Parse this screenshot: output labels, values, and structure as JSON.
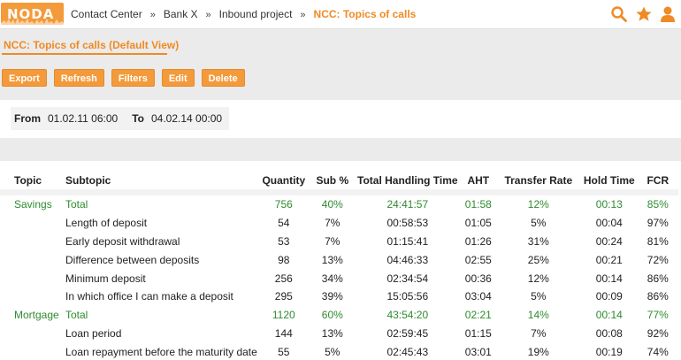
{
  "app": {
    "logo": "NODA"
  },
  "breadcrumb": [
    "Contact Center",
    "Bank X",
    "Inbound project"
  ],
  "breadcrumb_current": "NCC: Topics of calls",
  "page_title": "NCC: Topics of calls (Default View)",
  "toolbar": {
    "export": "Export",
    "refresh": "Refresh",
    "filters": "Filters",
    "edit": "Edit",
    "delete": "Delete"
  },
  "period": {
    "from_label": "From",
    "from_value": "01.02.11 06:00",
    "to_label": "To",
    "to_value": "04.02.14 00:00"
  },
  "colors": {
    "accent": "#f08a24",
    "total_green": "#2e8b2e"
  },
  "icons": [
    "search-icon",
    "star-icon",
    "user-icon"
  ],
  "table": {
    "columns": [
      "Topic",
      "Subtopic",
      "Quantity",
      "Sub %",
      "Total Handling Time",
      "AHT",
      "Transfer Rate",
      "Hold Time",
      "FCR"
    ],
    "rows": [
      [
        "Savings",
        "Total",
        "756",
        "40%",
        "24:41:57",
        "01:58",
        "12%",
        "00:13",
        "85%"
      ],
      [
        "",
        "Length of deposit",
        "54",
        "7%",
        "00:58:53",
        "01:05",
        "5%",
        "00:04",
        "97%"
      ],
      [
        "",
        "Early deposit withdrawal",
        "53",
        "7%",
        "01:15:41",
        "01:26",
        "31%",
        "00:24",
        "81%"
      ],
      [
        "",
        "Difference between deposits",
        "98",
        "13%",
        "04:46:33",
        "02:55",
        "25%",
        "00:21",
        "72%"
      ],
      [
        "",
        "Minimum deposit",
        "256",
        "34%",
        "02:34:54",
        "00:36",
        "12%",
        "00:14",
        "86%"
      ],
      [
        "",
        "In which office I can make a deposit",
        "295",
        "39%",
        "15:05:56",
        "03:04",
        "5%",
        "00:09",
        "86%"
      ],
      [
        "Mortgage",
        "Total",
        "1120",
        "60%",
        "43:54:20",
        "02:21",
        "14%",
        "00:14",
        "77%"
      ],
      [
        "",
        "Loan period",
        "144",
        "13%",
        "02:59:45",
        "01:15",
        "7%",
        "00:08",
        "92%"
      ],
      [
        "",
        "Loan repayment before the maturity date",
        "55",
        "5%",
        "02:45:43",
        "03:01",
        "19%",
        "00:19",
        "74%"
      ]
    ]
  }
}
